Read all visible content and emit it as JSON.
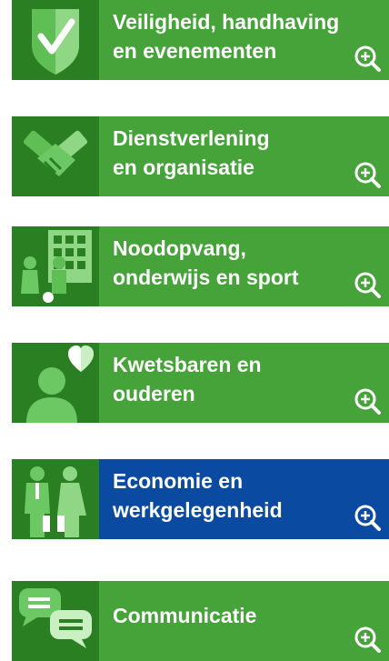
{
  "tiles": [
    {
      "id": "veiligheid",
      "line1": "Veiligheid, handhaving",
      "line2": "en evenementen",
      "icon": "shield-check-icon",
      "color": "#45a339"
    },
    {
      "id": "dienstverlening",
      "line1": "Dienstverlening",
      "line2": "en organisatie",
      "icon": "handshake-icon",
      "color": "#45a339"
    },
    {
      "id": "noodopvang",
      "line1": "Noodopvang,",
      "line2": "onderwijs en sport",
      "icon": "school-children-icon",
      "color": "#45a339"
    },
    {
      "id": "kwetsbaren",
      "line1": "Kwetsbaren en",
      "line2": "ouderen",
      "icon": "person-heart-icon",
      "color": "#45a339"
    },
    {
      "id": "economie",
      "line1": "Economie en",
      "line2": "werkgelegenheid",
      "icon": "business-people-icon",
      "color": "#0b4aa1"
    },
    {
      "id": "communicatie",
      "line1": "Communicatie",
      "line2": "",
      "icon": "chat-bubbles-icon",
      "color": "#45a339"
    }
  ],
  "zoom_icon": "zoom-in-icon"
}
